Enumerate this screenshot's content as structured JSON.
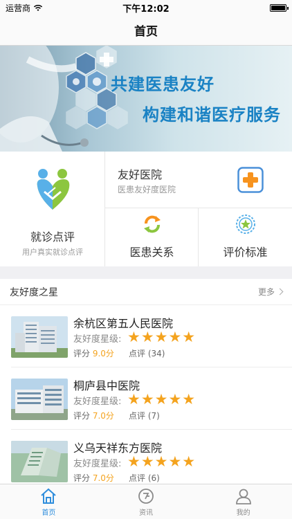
{
  "status_bar": {
    "carrier": "运营商",
    "time": "下午12:02"
  },
  "nav": {
    "title": "首页"
  },
  "banner": {
    "line1": "共建医患友好",
    "line2": "构建和谐医疗服务"
  },
  "quick_actions": {
    "consult_review": {
      "title": "就诊点评",
      "subtitle": "用户真实就诊点评"
    },
    "friendly_hospital": {
      "title": "友好医院",
      "subtitle": "医患友好度医院"
    },
    "doctor_patient": {
      "title": "医患关系"
    },
    "standard": {
      "title": "评价标准"
    }
  },
  "section": {
    "title": "友好度之星",
    "more": "更多"
  },
  "hospitals": [
    {
      "name": "余杭区第五人民医院",
      "rating_label": "友好度星级:",
      "stars": "★★★★★",
      "score_label": "评分",
      "score": "9.0分",
      "reviews": "点评 (34)"
    },
    {
      "name": "桐庐县中医院",
      "rating_label": "友好度星级:",
      "stars": "★★★★★",
      "score_label": "评分",
      "score": "7.0分",
      "reviews": "点评 (7)"
    },
    {
      "name": "义乌天祥东方医院",
      "rating_label": "友好度星级:",
      "stars": "★★★★★",
      "score_label": "评分",
      "score": "7.0分",
      "reviews": "点评 (6)"
    }
  ],
  "tabs": [
    {
      "label": "首页",
      "icon": "home-icon",
      "active": true
    },
    {
      "label": "资讯",
      "icon": "news-icon",
      "active": false
    },
    {
      "label": "我的",
      "icon": "profile-icon",
      "active": false
    }
  ],
  "colors": {
    "accent": "#2e8ddc",
    "star": "#f4a31e",
    "banner_text": "#1a82c4",
    "plus_orange": "#f7931e"
  }
}
